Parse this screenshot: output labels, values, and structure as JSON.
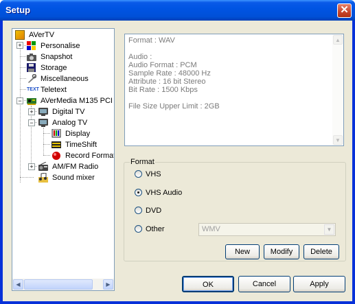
{
  "window": {
    "title": "Setup"
  },
  "tree": {
    "items": [
      {
        "label": "AVerTV",
        "icon": "avertv-icon"
      },
      {
        "label": "Personalise",
        "icon": "personalise-icon"
      },
      {
        "label": "Snapshot",
        "icon": "camera-icon"
      },
      {
        "label": "Storage",
        "icon": "disk-icon"
      },
      {
        "label": "Miscellaneous",
        "icon": "wrench-icon"
      },
      {
        "label": "Teletext",
        "icon": "teletext-icon"
      },
      {
        "label": "AVerMedia M135 PCI",
        "icon": "card-icon"
      },
      {
        "label": "Digital TV",
        "icon": "tv-icon"
      },
      {
        "label": "Analog TV",
        "icon": "tv-icon"
      },
      {
        "label": "Display",
        "icon": "display-icon"
      },
      {
        "label": "TimeShift",
        "icon": "timeshift-icon"
      },
      {
        "label": "Record Format",
        "icon": "record-icon"
      },
      {
        "label": "AM/FM Radio",
        "icon": "radio-icon"
      },
      {
        "label": "Sound mixer",
        "icon": "music-icon"
      }
    ]
  },
  "info": {
    "lines": [
      "Format : WAV",
      "",
      "Audio :",
      "Audio Format : PCM",
      "Sample Rate : 48000 Hz",
      "Attribute : 16 bit Stereo",
      "Bit Rate : 1500 Kbps",
      "",
      "File Size Upper Limit : 2GB"
    ]
  },
  "format_group": {
    "legend": "Format",
    "options": [
      {
        "label": "VHS",
        "selected": false
      },
      {
        "label": "VHS Audio",
        "selected": true
      },
      {
        "label": "DVD",
        "selected": false
      },
      {
        "label": "Other",
        "selected": false
      }
    ],
    "other_select_value": "WMV",
    "new_label": "New",
    "modify_label": "Modify",
    "delete_label": "Delete"
  },
  "footer": {
    "ok_label": "OK",
    "cancel_label": "Cancel",
    "apply_label": "Apply"
  }
}
